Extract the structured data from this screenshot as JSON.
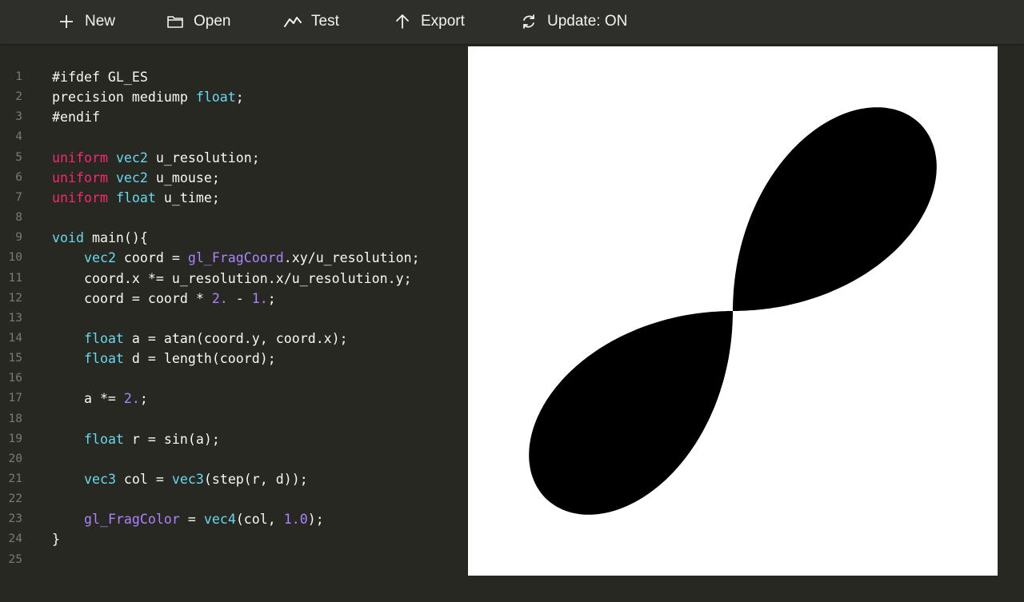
{
  "toolbar": {
    "items": [
      {
        "label": "New",
        "icon": "plus-icon"
      },
      {
        "label": "Open",
        "icon": "folder-icon"
      },
      {
        "label": "Test",
        "icon": "graph-icon"
      },
      {
        "label": "Export",
        "icon": "arrow-up-icon"
      },
      {
        "label": "Update: ON",
        "icon": "refresh-icon"
      }
    ]
  },
  "editor": {
    "line_numbers": [
      "1",
      "2",
      "3",
      "4",
      "5",
      "6",
      "7",
      "8",
      "9",
      "10",
      "11",
      "12",
      "13",
      "14",
      "15",
      "16",
      "17",
      "18",
      "19",
      "20",
      "21",
      "22",
      "23",
      "24",
      "25"
    ],
    "lines": [
      [
        {
          "t": "#ifdef GL_ES",
          "c": "plain"
        }
      ],
      [
        {
          "t": "precision mediump ",
          "c": "plain"
        },
        {
          "t": "float",
          "c": "type"
        },
        {
          "t": ";",
          "c": "plain"
        }
      ],
      [
        {
          "t": "#endif",
          "c": "plain"
        }
      ],
      [],
      [
        {
          "t": "uniform",
          "c": "kw"
        },
        {
          "t": " ",
          "c": "plain"
        },
        {
          "t": "vec2",
          "c": "type"
        },
        {
          "t": " u_resolution;",
          "c": "plain"
        }
      ],
      [
        {
          "t": "uniform",
          "c": "kw"
        },
        {
          "t": " ",
          "c": "plain"
        },
        {
          "t": "vec2",
          "c": "type"
        },
        {
          "t": " u_mouse;",
          "c": "plain"
        }
      ],
      [
        {
          "t": "uniform",
          "c": "kw"
        },
        {
          "t": " ",
          "c": "plain"
        },
        {
          "t": "float",
          "c": "type"
        },
        {
          "t": " u_time;",
          "c": "plain"
        }
      ],
      [],
      [
        {
          "t": "void",
          "c": "type"
        },
        {
          "t": " main(){",
          "c": "plain"
        }
      ],
      [
        {
          "t": "    ",
          "c": "plain"
        },
        {
          "t": "vec2",
          "c": "type"
        },
        {
          "t": " coord = ",
          "c": "plain"
        },
        {
          "t": "gl_FragCoord",
          "c": "builtin"
        },
        {
          "t": ".xy/u_resolution;",
          "c": "plain"
        }
      ],
      [
        {
          "t": "    coord.x *= u_resolution.x/u_resolution.y;",
          "c": "plain"
        }
      ],
      [
        {
          "t": "    coord = coord * ",
          "c": "plain"
        },
        {
          "t": "2.",
          "c": "num"
        },
        {
          "t": " - ",
          "c": "plain"
        },
        {
          "t": "1.",
          "c": "num"
        },
        {
          "t": ";",
          "c": "plain"
        }
      ],
      [],
      [
        {
          "t": "    ",
          "c": "plain"
        },
        {
          "t": "float",
          "c": "type"
        },
        {
          "t": " a = atan(coord.y, coord.x);",
          "c": "plain"
        }
      ],
      [
        {
          "t": "    ",
          "c": "plain"
        },
        {
          "t": "float",
          "c": "type"
        },
        {
          "t": " d = length(coord);",
          "c": "plain"
        }
      ],
      [],
      [
        {
          "t": "    a *= ",
          "c": "plain"
        },
        {
          "t": "2.",
          "c": "num"
        },
        {
          "t": ";",
          "c": "plain"
        }
      ],
      [],
      [
        {
          "t": "    ",
          "c": "plain"
        },
        {
          "t": "float",
          "c": "type"
        },
        {
          "t": " r = sin(a);",
          "c": "plain"
        }
      ],
      [],
      [
        {
          "t": "    ",
          "c": "plain"
        },
        {
          "t": "vec3",
          "c": "type"
        },
        {
          "t": " col = ",
          "c": "plain"
        },
        {
          "t": "vec3",
          "c": "type"
        },
        {
          "t": "(step(r, d));",
          "c": "plain"
        }
      ],
      [],
      [
        {
          "t": "    ",
          "c": "plain"
        },
        {
          "t": "gl_FragColor",
          "c": "builtin"
        },
        {
          "t": " = ",
          "c": "plain"
        },
        {
          "t": "vec4",
          "c": "type"
        },
        {
          "t": "(col, ",
          "c": "plain"
        },
        {
          "t": "1.0",
          "c": "num"
        },
        {
          "t": ");",
          "c": "plain"
        }
      ],
      [
        {
          "t": "}",
          "c": "plain"
        }
      ],
      []
    ]
  },
  "preview": {
    "background": "#ffffff",
    "shape_fill": "#000000"
  },
  "colors": {
    "editor_bg": "#272822",
    "toolbar_bg": "#2e2f2a",
    "keyword": "#f92672",
    "type": "#66d9ef",
    "number": "#ae81ff",
    "text": "#f8f8f2",
    "gutter": "#7a7b72"
  }
}
